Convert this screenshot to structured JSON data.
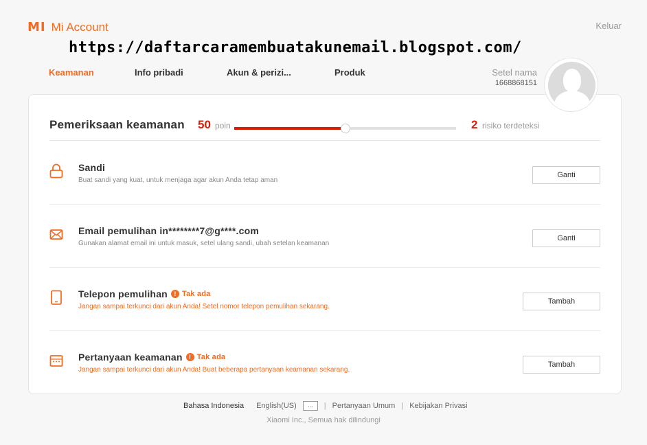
{
  "header": {
    "logo_mark": "MI",
    "logo_text": "Mi Account",
    "logout": "Keluar",
    "watermark": "https://daftarcaramembuatakunemail.blogspot.com/"
  },
  "tabs": [
    {
      "label": "Keamanan",
      "active": true
    },
    {
      "label": "Info pribadi",
      "active": false
    },
    {
      "label": "Akun & perizi...",
      "active": false
    },
    {
      "label": "Produk",
      "active": false
    }
  ],
  "user": {
    "name_action": "Setel nama",
    "id": "1668868151"
  },
  "security_check": {
    "title": "Pemeriksaan keamanan",
    "score": "50",
    "score_unit": "poin",
    "score_fraction": 0.5,
    "risk_count": "2",
    "risk_label": "risiko terdeteksi"
  },
  "items": [
    {
      "icon": "lock-icon",
      "title": "Sandi",
      "warning": "",
      "description": "Buat sandi yang kuat, untuk menjaga agar akun Anda tetap aman",
      "button": "Ganti"
    },
    {
      "icon": "envelope-icon",
      "title": "Email pemulihan in********7@g****.com",
      "warning": "",
      "description": "Gunakan alamat email ini untuk masuk, setel ulang sandi, ubah setelan keamanan",
      "button": "Ganti"
    },
    {
      "icon": "phone-icon",
      "title": "Telepon pemulihan",
      "warning": "Tak ada",
      "description": "Jangan sampai terkunci dari akun Anda! Setel nomor telepon pemulihan sekarang.",
      "button": "Tambah"
    },
    {
      "icon": "question-box-icon",
      "title": "Pertanyaan keamanan",
      "warning": "Tak ada",
      "description": "Jangan sampai terkunci dari akun Anda! Buat beberapa pertanyaan keamanan sekarang.",
      "button": "Tambah"
    }
  ],
  "footer": {
    "lang_current": "Bahasa Indonesia",
    "lang_other": "English(US)",
    "lang_more": "...",
    "faq": "Pertanyaan Umum",
    "privacy": "Kebijakan Privasi",
    "separator": "|",
    "copyright": "Xiaomi Inc., Semua hak dilindungi"
  },
  "colors": {
    "accent": "#f36b21",
    "score": "#d81e06"
  }
}
